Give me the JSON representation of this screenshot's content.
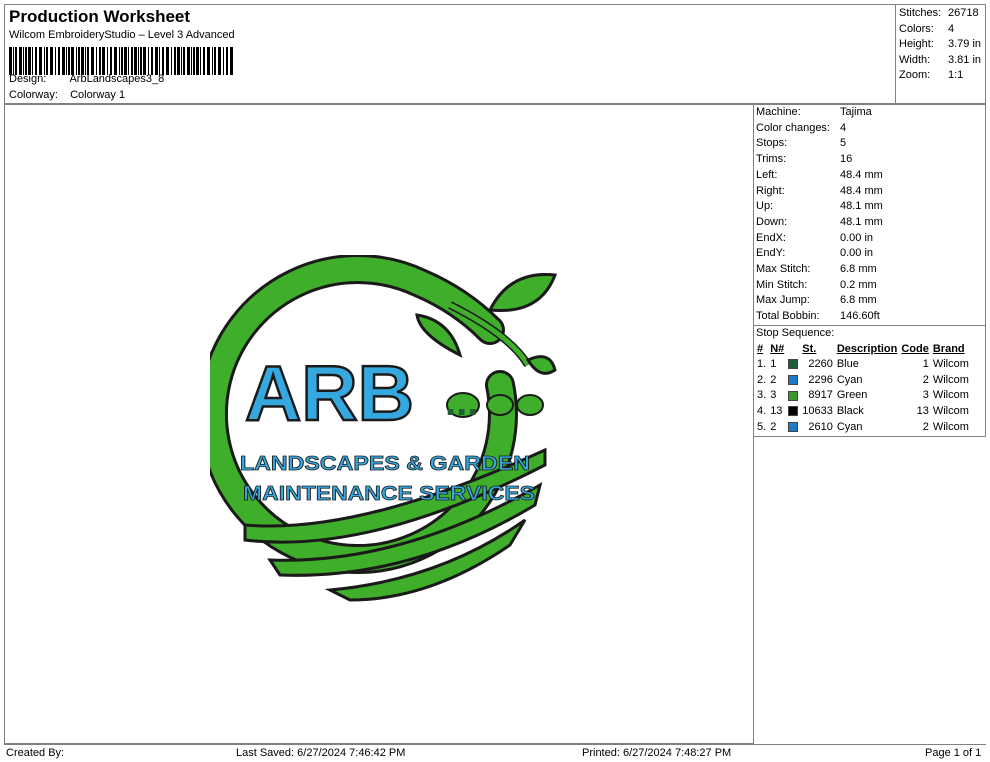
{
  "header": {
    "title": "Production Worksheet",
    "subtitle": "Wilcom EmbroideryStudio – Level 3 Advanced",
    "design_label": "Design:",
    "design_value": "ArbLandscapes3_8",
    "colorway_label": "Colorway:",
    "colorway_value": "Colorway 1"
  },
  "summary": [
    {
      "label": "Stitches:",
      "value": "26718"
    },
    {
      "label": "Colors:",
      "value": "4"
    },
    {
      "label": "Height:",
      "value": "3.79 in"
    },
    {
      "label": "Width:",
      "value": "3.81 in"
    },
    {
      "label": "Zoom:",
      "value": "1:1"
    }
  ],
  "info": [
    {
      "label": "Machine:",
      "value": "Tajima"
    },
    {
      "label": "Color changes:",
      "value": "4"
    },
    {
      "label": "Stops:",
      "value": "5"
    },
    {
      "label": "Trims:",
      "value": "16"
    },
    {
      "label": "Left:",
      "value": "48.4 mm"
    },
    {
      "label": "Right:",
      "value": "48.4 mm"
    },
    {
      "label": "Up:",
      "value": "48.1 mm"
    },
    {
      "label": "Down:",
      "value": "48.1 mm"
    },
    {
      "label": "EndX:",
      "value": "0.00 in"
    },
    {
      "label": "EndY:",
      "value": "0.00 in"
    },
    {
      "label": "Max Stitch:",
      "value": "6.8 mm"
    },
    {
      "label": "Min Stitch:",
      "value": "0.2 mm"
    },
    {
      "label": "Max Jump:",
      "value": "6.8 mm"
    },
    {
      "label": "Total Bobbin:",
      "value": "146.60ft"
    }
  ],
  "stop_sequence": {
    "label": "Stop Sequence:",
    "headers": [
      "#",
      "N#",
      "St.",
      "Description",
      "Code",
      "Brand"
    ],
    "rows": [
      {
        "idx": "1.",
        "n": "1",
        "color": "#1e5a3c",
        "st": "2260",
        "desc": "Blue",
        "code": "1",
        "brand": "Wilcom"
      },
      {
        "idx": "2.",
        "n": "2",
        "color": "#1f78c8",
        "st": "2296",
        "desc": "Cyan",
        "code": "2",
        "brand": "Wilcom"
      },
      {
        "idx": "3.",
        "n": "3",
        "color": "#3c9a2a",
        "st": "8917",
        "desc": "Green",
        "code": "3",
        "brand": "Wilcom"
      },
      {
        "idx": "4.",
        "n": "13",
        "color": "#000000",
        "st": "10633",
        "desc": "Black",
        "code": "13",
        "brand": "Wilcom"
      },
      {
        "idx": "5.",
        "n": "2",
        "color": "#1f78c8",
        "st": "2610",
        "desc": "Cyan",
        "code": "2",
        "brand": "Wilcom"
      }
    ]
  },
  "design": {
    "main_text": "ARB",
    "line1": "LANDSCAPES & GARDEN",
    "line2": "MAINTENANCE SERVICES",
    "colors": {
      "green": "#3fae2a",
      "cyan": "#35a8e0",
      "black": "#1a1a1a",
      "dark_green": "#1f5e34"
    }
  },
  "footer": {
    "created_by": "Created By:",
    "last_saved": "Last Saved: 6/27/2024 7:46:42 PM",
    "printed": "Printed: 6/27/2024 7:48:27 PM",
    "page": "Page 1 of 1"
  }
}
